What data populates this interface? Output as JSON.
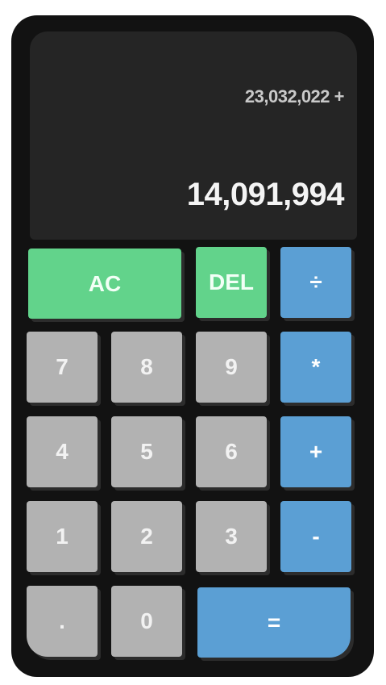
{
  "display": {
    "previous": "23,032,022 +",
    "current": "14,091,994"
  },
  "keys": {
    "ac": "AC",
    "del": "DEL",
    "divide": "÷",
    "seven": "7",
    "eight": "8",
    "nine": "9",
    "multiply": "*",
    "four": "4",
    "five": "5",
    "six": "6",
    "add": "+",
    "one": "1",
    "two": "2",
    "three": "3",
    "subtract": "-",
    "decimal": ".",
    "zero": "0",
    "equals": "="
  },
  "colors": {
    "frame": "#121212",
    "display": "#252525",
    "number_key": "#b2b2b2",
    "operator_key": "#5b9fd4",
    "function_key": "#62d38b"
  }
}
